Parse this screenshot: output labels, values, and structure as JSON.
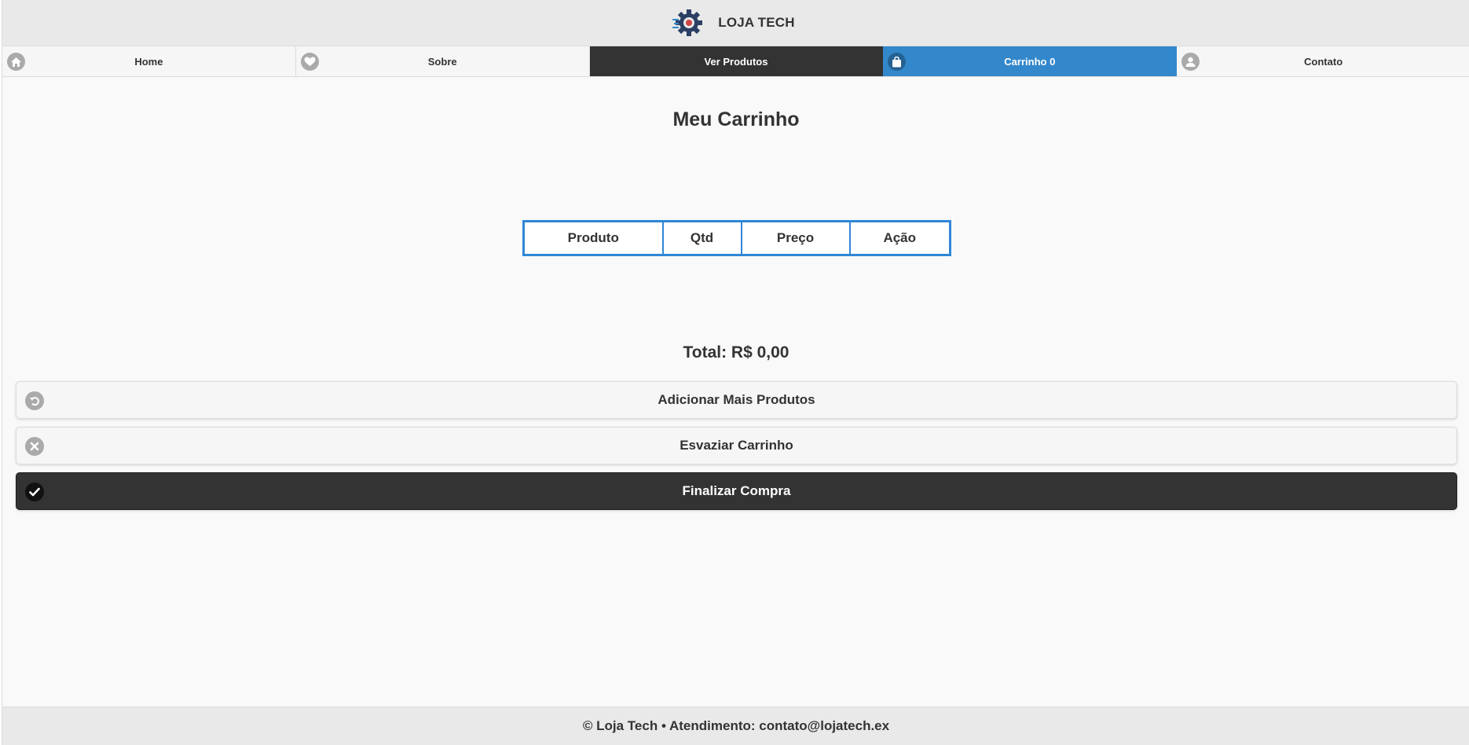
{
  "header": {
    "brand": "LOJA TECH",
    "logo_icon": "gear-logo-icon"
  },
  "nav": {
    "items": [
      {
        "label": "Home",
        "icon": "home-icon",
        "state": "normal"
      },
      {
        "label": "Sobre",
        "icon": "heart-icon",
        "state": "normal"
      },
      {
        "label": "Ver Produtos",
        "icon": "",
        "state": "active"
      },
      {
        "label": "Carrinho 0",
        "icon": "shopping-bag-icon",
        "state": "highlight"
      },
      {
        "label": "Contato",
        "icon": "user-icon",
        "state": "normal"
      }
    ]
  },
  "main": {
    "title": "Meu Carrinho",
    "table": {
      "headers": [
        "Produto",
        "Qtd",
        "Preço",
        "Ação"
      ],
      "rows": []
    },
    "total": "Total: R$ 0,00",
    "buttons": {
      "add_more": "Adicionar Mais Produtos",
      "empty_cart": "Esvaziar Carrinho",
      "checkout": "Finalizar Compra"
    }
  },
  "footer": {
    "text": "© Loja Tech • Atendimento: contato@lojatech.ex"
  },
  "colors": {
    "accent": "#3388cc",
    "table_border": "#2f86d6",
    "dark": "#333333",
    "background": "#f9f9f9"
  }
}
